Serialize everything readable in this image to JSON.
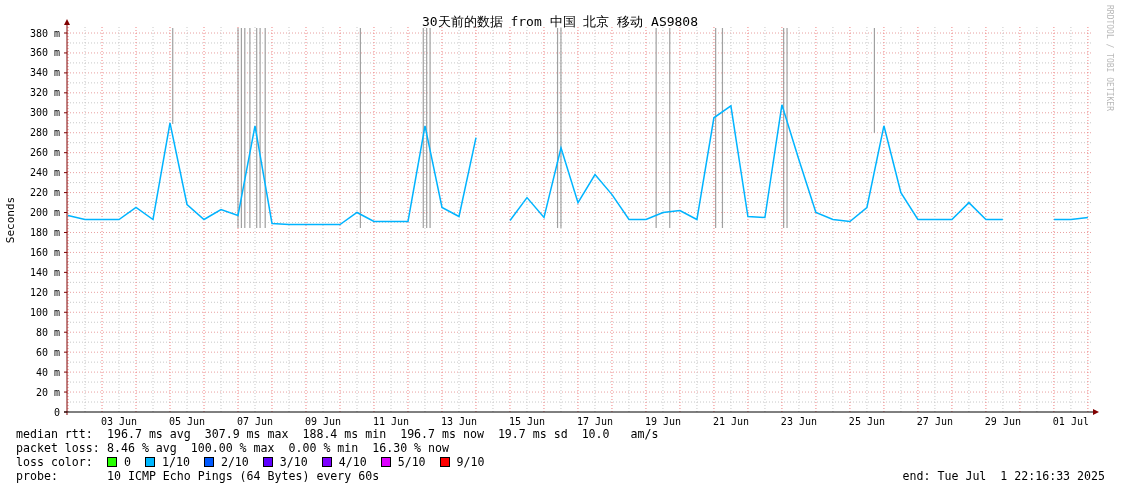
{
  "chart": {
    "side_label": "RRDTOOL / TOBI OETIKER",
    "chart_data": {
      "type": "line",
      "title": "30天前的数据 from 中国 北京 移动 AS9808",
      "ylabel": "Seconds",
      "ylim": [
        0,
        380
      ],
      "yticks": [
        {
          "value": 0,
          "label": "0"
        },
        {
          "value": 20,
          "label": "20 m"
        },
        {
          "value": 40,
          "label": "40 m"
        },
        {
          "value": 60,
          "label": "60 m"
        },
        {
          "value": 80,
          "label": "80 m"
        },
        {
          "value": 100,
          "label": "100 m"
        },
        {
          "value": 120,
          "label": "120 m"
        },
        {
          "value": 140,
          "label": "140 m"
        },
        {
          "value": 160,
          "label": "160 m"
        },
        {
          "value": 180,
          "label": "180 m"
        },
        {
          "value": 200,
          "label": "200 m"
        },
        {
          "value": 220,
          "label": "220 m"
        },
        {
          "value": 240,
          "label": "240 m"
        },
        {
          "value": 260,
          "label": "260 m"
        },
        {
          "value": 280,
          "label": "280 m"
        },
        {
          "value": 300,
          "label": "300 m"
        },
        {
          "value": 320,
          "label": "320 m"
        },
        {
          "value": 340,
          "label": "340 m"
        },
        {
          "value": 360,
          "label": "360 m"
        },
        {
          "value": 380,
          "label": "380 m"
        }
      ],
      "categories": [
        null,
        null,
        null,
        "03 Jun",
        null,
        null,
        null,
        "05 Jun",
        null,
        null,
        null,
        "07 Jun",
        null,
        null,
        null,
        "09 Jun",
        null,
        null,
        null,
        "11 Jun",
        null,
        null,
        null,
        "13 Jun",
        null,
        null,
        null,
        "15 Jun",
        null,
        null,
        null,
        "17 Jun",
        null,
        null,
        null,
        "19 Jun",
        null,
        null,
        null,
        "21 Jun",
        null,
        null,
        null,
        "23 Jun",
        null,
        null,
        null,
        "25 Jun",
        null,
        null,
        null,
        "27 Jun",
        null,
        null,
        null,
        "29 Jun",
        null,
        null,
        null,
        "01 Jul",
        null
      ],
      "grid": true,
      "series": [
        {
          "color": "#00b4ff",
          "values": [
            197,
            193,
            193,
            193,
            205,
            193,
            290,
            208,
            193,
            203,
            197,
            287,
            189,
            188,
            188,
            188,
            188,
            200,
            191,
            191,
            191,
            287,
            205,
            196,
            275,
            null,
            192,
            215,
            195,
            265,
            210,
            238,
            218,
            193,
            193,
            200,
            202,
            193,
            295,
            307,
            196,
            195,
            308,
            253,
            200,
            193,
            191,
            205,
            287,
            220,
            193,
            193,
            193,
            210,
            193,
            193,
            null,
            null,
            193,
            193,
            195
          ]
        }
      ]
    }
  },
  "stats": [
    {
      "label": "median rtt:",
      "value": "196.7 ms avg  307.9 ms max  188.4 ms min  196.7 ms now  19.7 ms sd  10.0   am/s"
    },
    {
      "label": "packet loss:",
      "value": "8.46 % avg  100.00 % max  0.00 % min  16.30 % now"
    }
  ],
  "loss_legend": {
    "label": "loss color:",
    "items": [
      {
        "label": "0",
        "color": "#26ff00"
      },
      {
        "label": "1/10",
        "color": "#00b8ff"
      },
      {
        "label": "2/10",
        "color": "#0059ff"
      },
      {
        "label": "3/10",
        "color": "#5e00ff"
      },
      {
        "label": "4/10",
        "color": "#7e00ff"
      },
      {
        "label": "5/10",
        "color": "#dd00ff"
      },
      {
        "label": "9/10",
        "color": "#ff0000"
      }
    ]
  },
  "probe": {
    "label": "probe:",
    "value": "10 ICMP Echo Pings (64 Bytes) every 60s"
  },
  "end": "end: Tue Jul  1 22:16:33 2025"
}
